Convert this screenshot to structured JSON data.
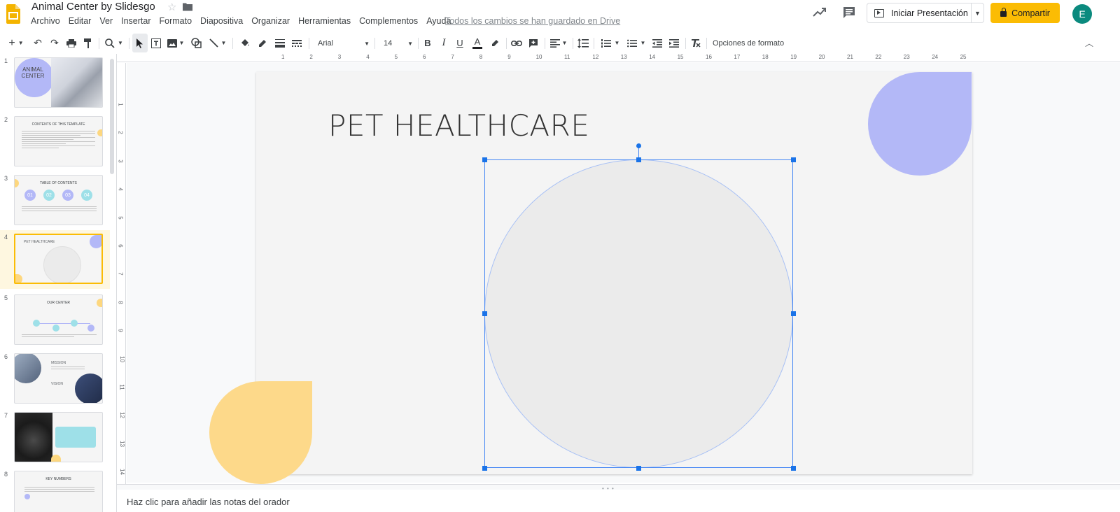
{
  "app": {
    "doc_title": "Animal Center by Slidesgo",
    "save_status": "Todos los cambios se han guardado en Drive",
    "brand_color": "#fbbc04"
  },
  "menu": [
    "Archivo",
    "Editar",
    "Ver",
    "Insertar",
    "Formato",
    "Diapositiva",
    "Organizar",
    "Herramientas",
    "Complementos",
    "Ayuda"
  ],
  "header": {
    "present_label": "Iniciar Presentación",
    "share_label": "Compartir",
    "avatar_letter": "E",
    "avatar_color": "#0b8a7e"
  },
  "toolbar": {
    "font": "Arial",
    "font_size": "14",
    "format_options": "Opciones de formato"
  },
  "ruler": {
    "h_ticks": [
      "1",
      "2",
      "3",
      "4",
      "5",
      "6",
      "7",
      "8",
      "9",
      "10",
      "11",
      "12",
      "13",
      "14",
      "15",
      "16",
      "17",
      "18",
      "19",
      "20",
      "21",
      "22",
      "23",
      "24",
      "25"
    ],
    "v_ticks": [
      "1",
      "2",
      "3",
      "4",
      "5",
      "6",
      "7",
      "8",
      "9",
      "10",
      "11",
      "12",
      "13",
      "14"
    ]
  },
  "filmstrip": {
    "slides": [
      {
        "number": "1",
        "title": "ANIMAL CENTER"
      },
      {
        "number": "2",
        "title": "CONTENTS OF THIS TEMPLATE"
      },
      {
        "number": "3",
        "title": "TABLE OF CONTENTS",
        "items": [
          "01",
          "02",
          "03",
          "04"
        ]
      },
      {
        "number": "4",
        "title": "PET HEALTHCARE"
      },
      {
        "number": "5",
        "title": "OUR CENTER"
      },
      {
        "number": "6",
        "title": "MISSION",
        "subtitle": "VISION"
      },
      {
        "number": "7",
        "title": ""
      },
      {
        "number": "8",
        "title": "KEY NUMBERS"
      }
    ],
    "active_index": 3
  },
  "slide": {
    "title": "PET HEALTHCARE",
    "colors": {
      "blue_leaf": "#b3b8f7",
      "yellow_leaf": "#fdd98a",
      "circle": "#ebebeb",
      "selection": "#1a73e8"
    }
  },
  "notes": {
    "placeholder": "Haz clic para añadir las notas del orador"
  }
}
